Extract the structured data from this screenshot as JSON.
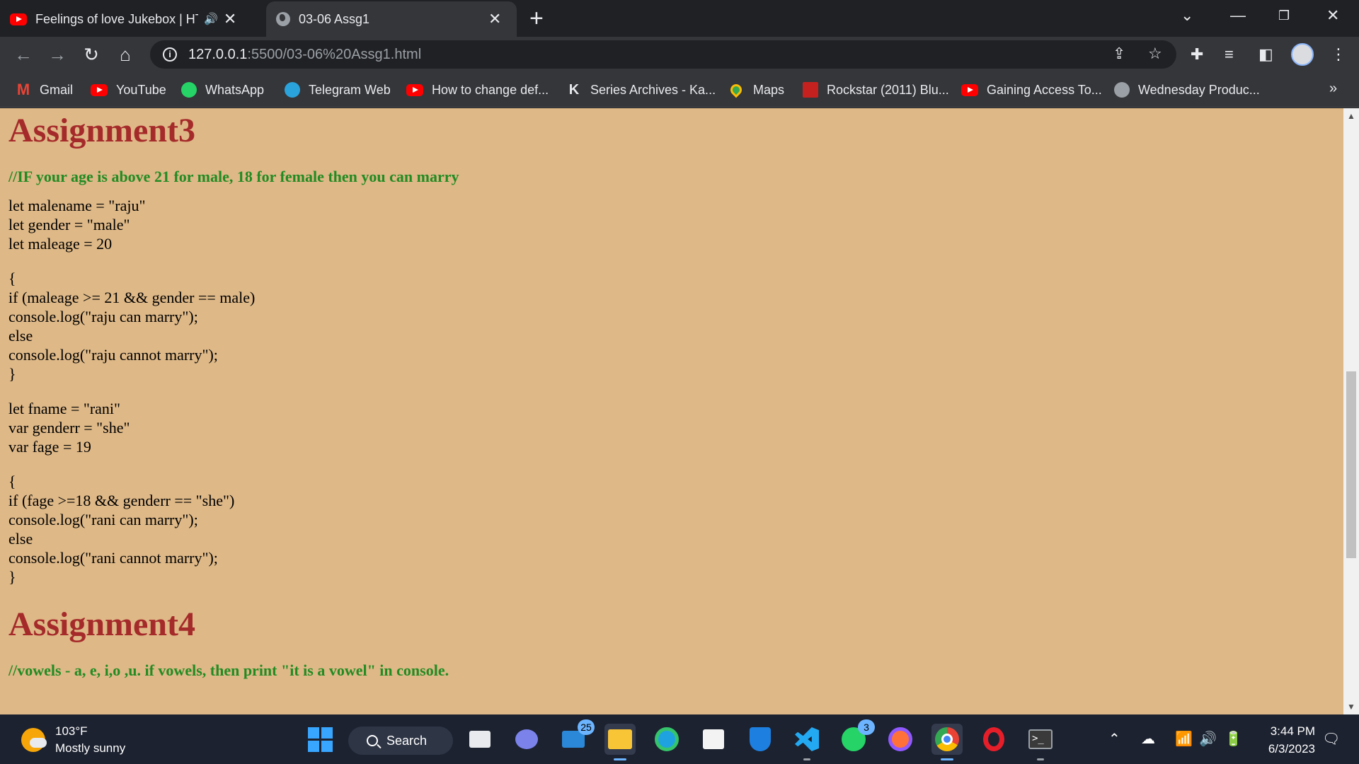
{
  "browser": {
    "tabs": [
      {
        "title": "Feelings of love Jukebox | HT",
        "icon": "youtube-icon"
      },
      {
        "title": "03-06 Assg1",
        "icon": "globe-icon"
      }
    ],
    "new_tab": "+",
    "url_host": "127.0.0.1",
    "url_rest": ":5500/03-06%20Assg1.html",
    "bookmarks": [
      {
        "label": "Gmail",
        "icon": "gmail-icon"
      },
      {
        "label": "YouTube",
        "icon": "youtube-icon"
      },
      {
        "label": "WhatsApp",
        "icon": "whatsapp-icon"
      },
      {
        "label": "Telegram Web",
        "icon": "telegram-icon"
      },
      {
        "label": "How to change def...",
        "icon": "youtube-icon"
      },
      {
        "label": "Series Archives - Ka...",
        "icon": "k-icon"
      },
      {
        "label": "Maps",
        "icon": "maps-icon"
      },
      {
        "label": "Rockstar (2011) Blu...",
        "icon": "rockstar-icon"
      },
      {
        "label": "Gaining Access To...",
        "icon": "youtube-icon"
      },
      {
        "label": "Wednesday Produc...",
        "icon": "globe-icon"
      }
    ],
    "bookmarks_more": "»"
  },
  "page": {
    "background": "#deb887",
    "heading_color": "#a52a2a",
    "comment_color": "#228b22",
    "assignment3": {
      "title": "Assignment3",
      "comment": "//IF your age is above 21 for male, 18 for female then you can marry",
      "block1": [
        "let malename = \"raju\"",
        "let gender = \"male\"",
        "let maleage = 20"
      ],
      "block2": [
        "{",
        "if (maleage >= 21 && gender == male)",
        "console.log(\"raju can marry\");",
        "else",
        "console.log(\"raju cannot marry\");",
        "}"
      ],
      "block3": [
        "let fname = \"rani\"",
        "var genderr = \"she\"",
        "var fage = 19"
      ],
      "block4": [
        "{",
        "if (fage >=18 && genderr == \"she\")",
        "console.log(\"rani can marry\");",
        "else",
        "console.log(\"rani cannot marry\");",
        "}"
      ]
    },
    "assignment4": {
      "title": "Assignment4",
      "comment": "//vowels - a, e, i,o ,u. if vowels, then print \"it is a vowel\" in console."
    }
  },
  "taskbar": {
    "weather": {
      "temp": "103°F",
      "condition": "Mostly sunny"
    },
    "search_label": "Search",
    "mail_badge": "25",
    "whatsapp_badge": "3",
    "time": "3:44 PM",
    "date": "6/3/2023"
  }
}
